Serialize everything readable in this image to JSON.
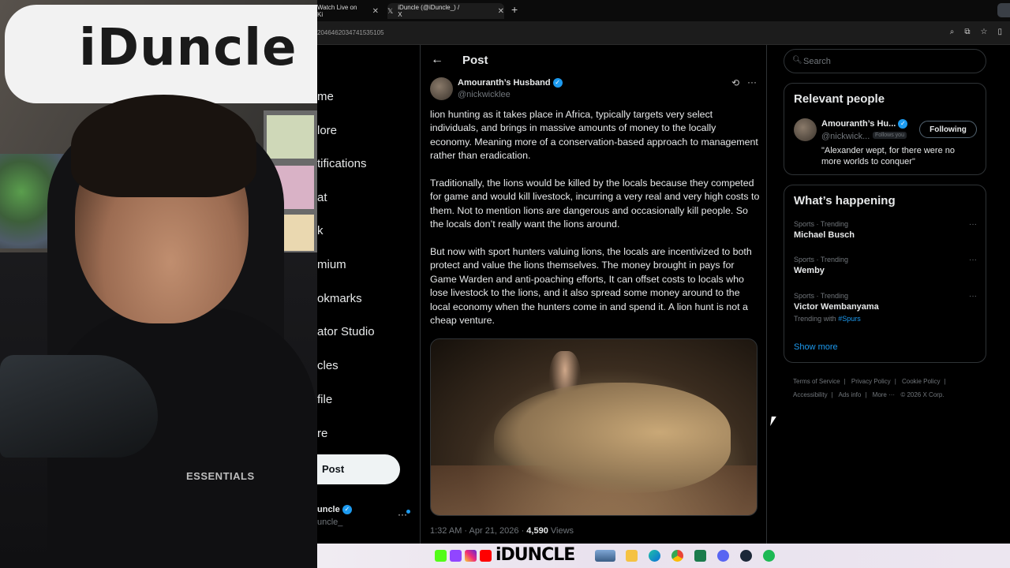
{
  "browser": {
    "tabs": [
      {
        "label": "Watch Live on Ki"
      },
      {
        "label": "iDuncle (@iDuncle_) / X"
      }
    ],
    "url": "2046462034741535105"
  },
  "nav": {
    "items": [
      "me",
      "lore",
      "tifications",
      "at",
      "k",
      "mium",
      "okmarks",
      "ator Studio",
      "cles",
      "file",
      "re"
    ],
    "post_button": "Post",
    "account_name": "uncle",
    "account_handle": "uncle_"
  },
  "post": {
    "header_title": "Post",
    "author_name": "Amouranth’s Husband",
    "author_handle": "@nickwicklee",
    "paragraphs": [
      "lion hunting as it takes place in Africa, typically targets very select individuals, and brings in massive amounts of money to the locally economy. Meaning more of a conservation-based approach to management rather than eradication.",
      "Traditionally, the lions would be killed by the locals because they competed for game and would kill livestock, incurring a very real and very high costs to them. Not to mention lions are dangerous and occasionally kill people. So the locals don’t really want the lions around.",
      "But now with sport hunters valuing lions, the locals are incentivized to both protect and value the lions themselves. The money brought in pays for Game Warden and anti-poaching efforts, It can offset costs to locals who lose livestock to the lions, and  it also spread some money around to the local economy when the hunters come in and spend it. A lion hunt is not a cheap venture."
    ],
    "time": "1:32 AM · Apr 21, 2026 · ",
    "views_count": "4,590",
    "views_label": " Views"
  },
  "sidebar": {
    "search_placeholder": "Search",
    "relevant_title": "Relevant people",
    "relevant_person": {
      "name": "Amouranth’s Hu...",
      "handle": "@nickwick...",
      "follows_you": "Follows you",
      "follow_button": "Following",
      "bio": "\"Alexander wept, for there were no more worlds to conquer\""
    },
    "happening_title": "What’s happening",
    "trends": [
      {
        "category": "Sports · Trending",
        "name": "Michael Busch"
      },
      {
        "category": "Sports · Trending",
        "name": "Wemby"
      },
      {
        "category": "Sports · Trending",
        "name": "Victor Wembanyama",
        "with_label": "Trending with ",
        "with_tag": "#Spurs"
      }
    ],
    "show_more": "Show more",
    "footer": [
      "Terms of Service",
      "|",
      "Privacy Policy",
      "|",
      "Cookie Policy",
      "|",
      "Accessibility",
      "|",
      "Ads info",
      "|",
      "More ···",
      "© 2026 X Corp."
    ]
  },
  "overlay": {
    "board_text": "iDuncle",
    "shirt_text": "ESSENTIALS",
    "taskbar_brand": "iDUNCLE"
  },
  "colors": {
    "accent": "#1d9bf0",
    "background": "#000000",
    "border": "#2f3336",
    "muted_text": "#71767b"
  }
}
